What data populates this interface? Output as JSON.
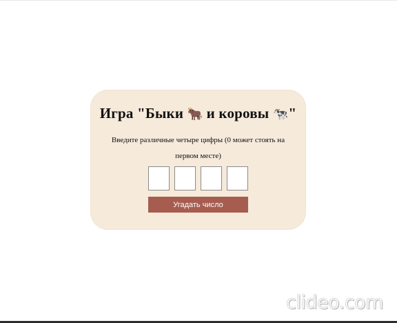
{
  "game": {
    "title_text": "Игра \"Быки ",
    "bull_emoji": "🐂",
    "title_mid": " и коровы ",
    "cow_emoji": "🐄",
    "title_end": "\"",
    "instruction": "Введите различные четыре цифры (0 может стоять на первом месте)",
    "digits": [
      "",
      "",
      "",
      ""
    ],
    "guess_button_label": "Угадать число"
  },
  "watermark": {
    "text": "clideo.com"
  }
}
